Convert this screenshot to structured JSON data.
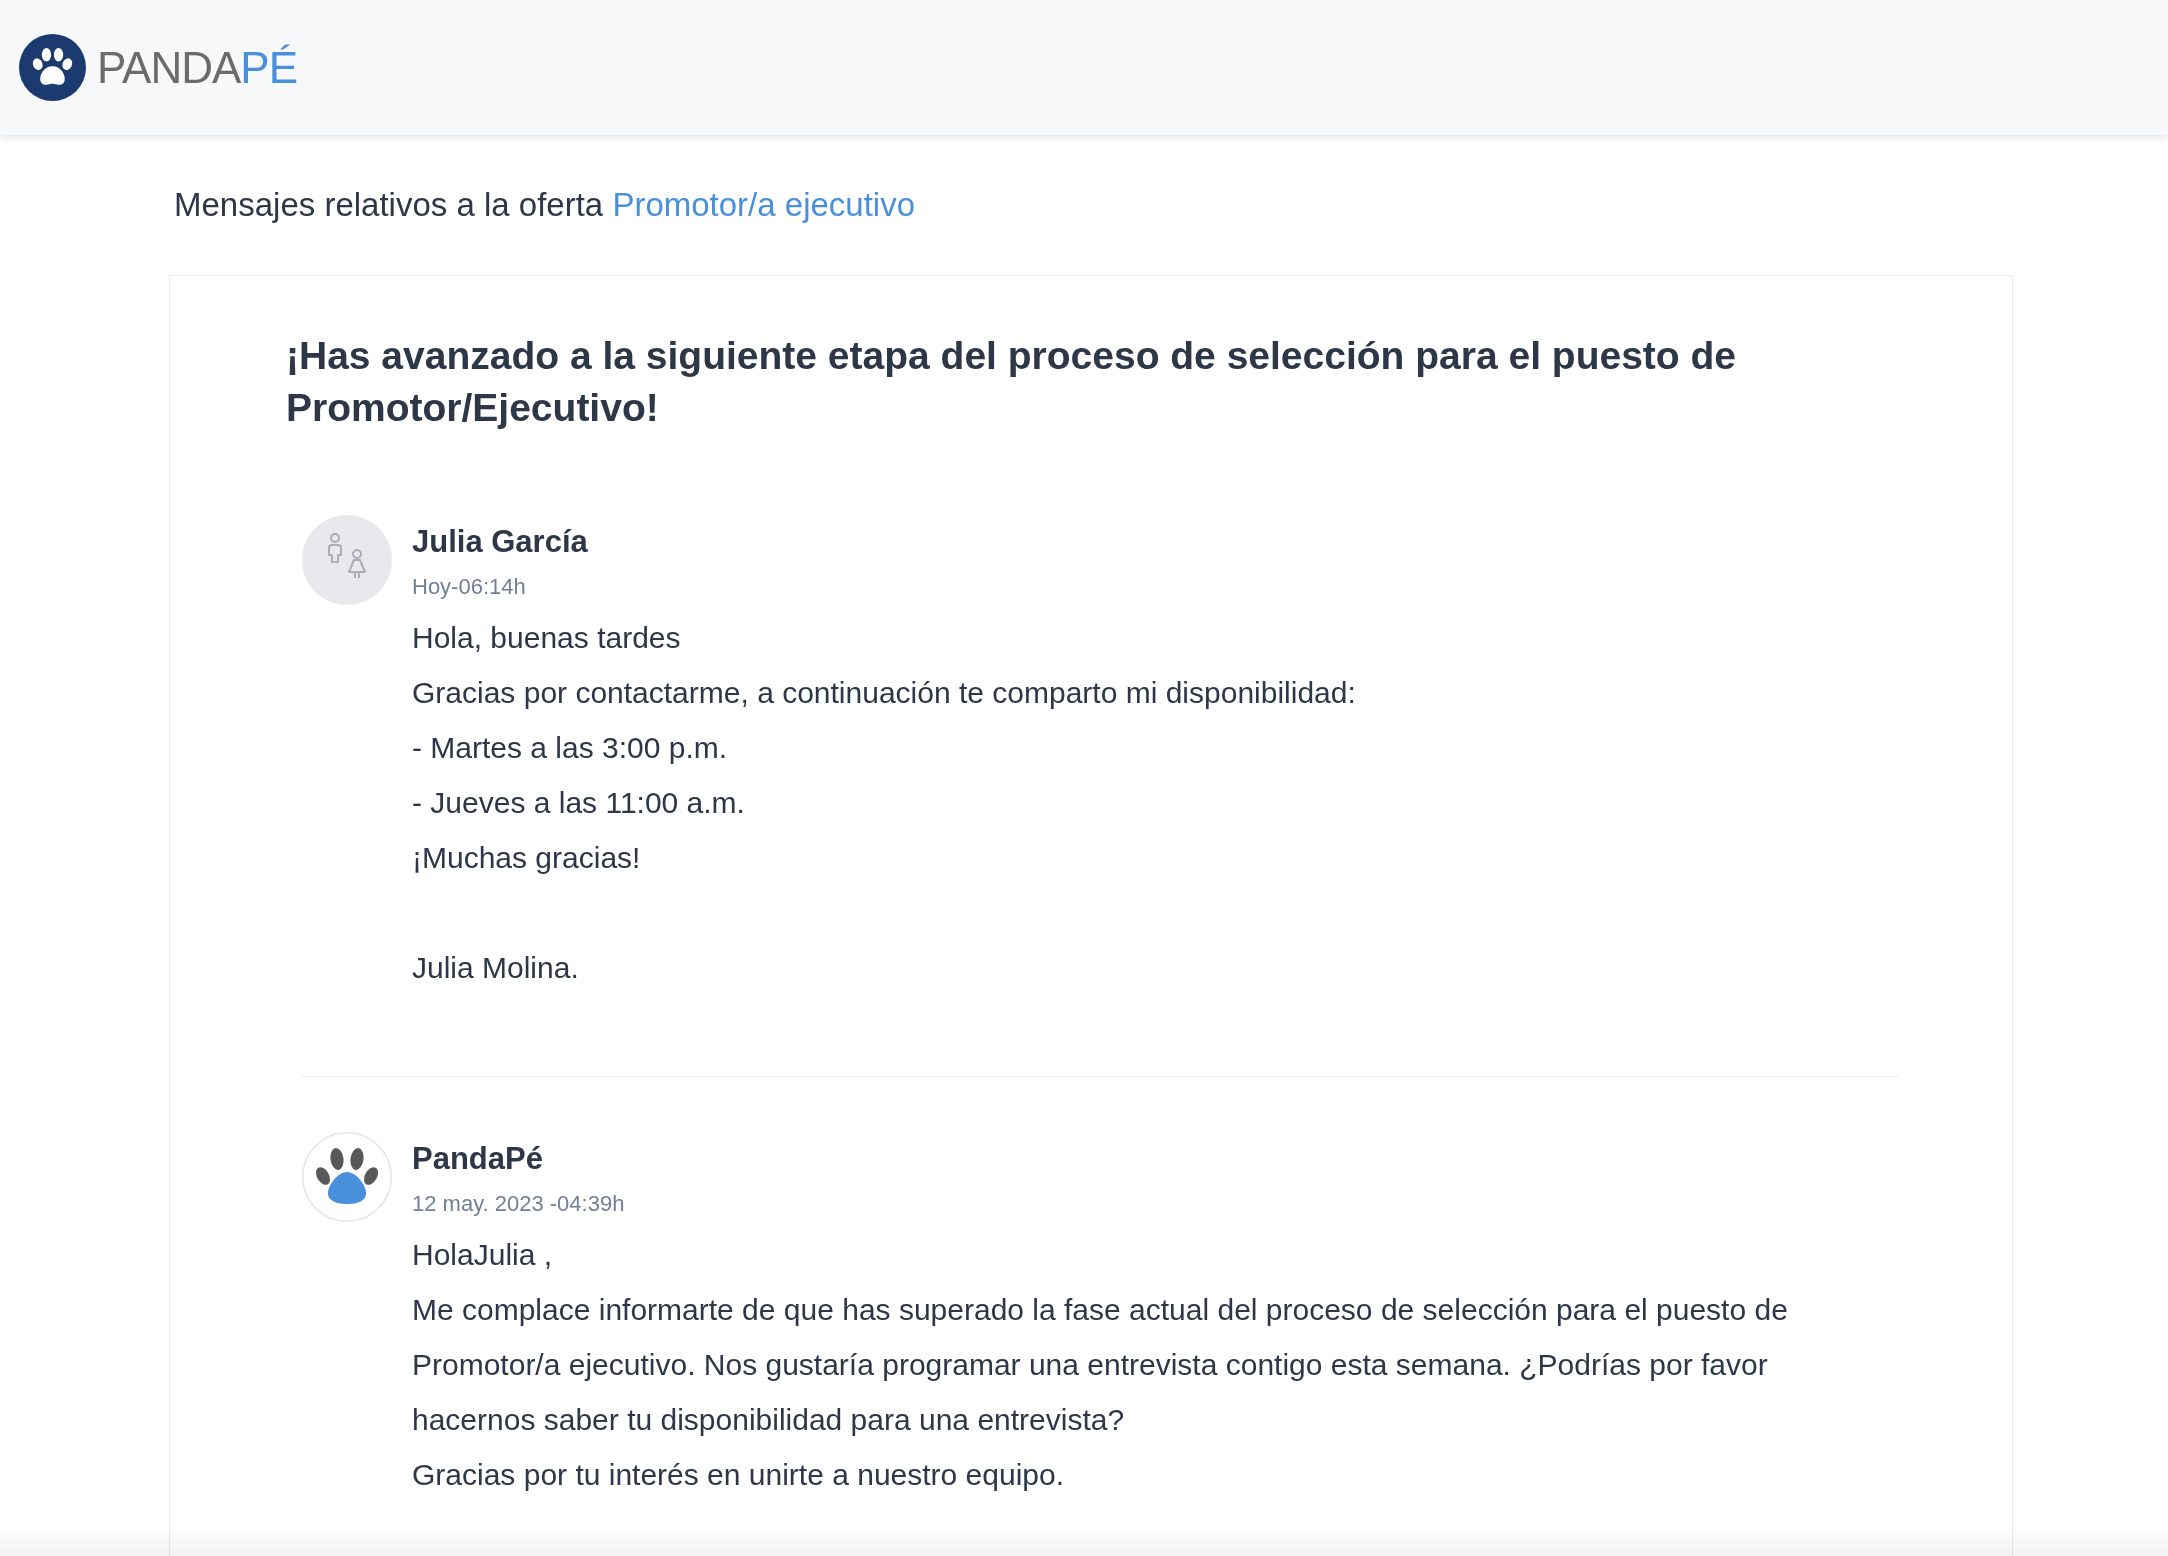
{
  "header": {
    "logo": {
      "text": "PANDA",
      "accent": "PÉ"
    }
  },
  "offer": {
    "prefix": "Mensajes relativos a la oferta",
    "link": "Promotor/a ejecutivo"
  },
  "thread": {
    "title": "¡Has avanzado a la siguiente etapa del proceso de selección para el puesto de Promotor/Ejecutivo!",
    "messages": [
      {
        "kind": "candidate",
        "sender": "Julia García",
        "time": "Hoy-06:14h",
        "body": [
          "Hola, buenas tardes",
          "Gracias por contactarme, a continuación te comparto mi disponibilidad:",
          "- Martes a las 3:00 p.m.",
          "- Jueves a las 11:00 a.m.",
          "¡Muchas gracias!"
        ],
        "signature": "Julia Molina."
      },
      {
        "kind": "company",
        "sender": "PandaPé",
        "time": "12 may. 2023 -04:39h",
        "body": [
          "HolaJulia ,",
          "Me complace informarte de que has superado la fase actual del proceso de selección para el puesto de Promotor/a ejecutivo. Nos gustaría programar una entrevista contigo esta semana. ¿Podrías por favor hacernos saber tu disponibilidad para una entrevista?",
          "Gracias por tu interés en unirte a nuestro equipo."
        ]
      }
    ]
  }
}
